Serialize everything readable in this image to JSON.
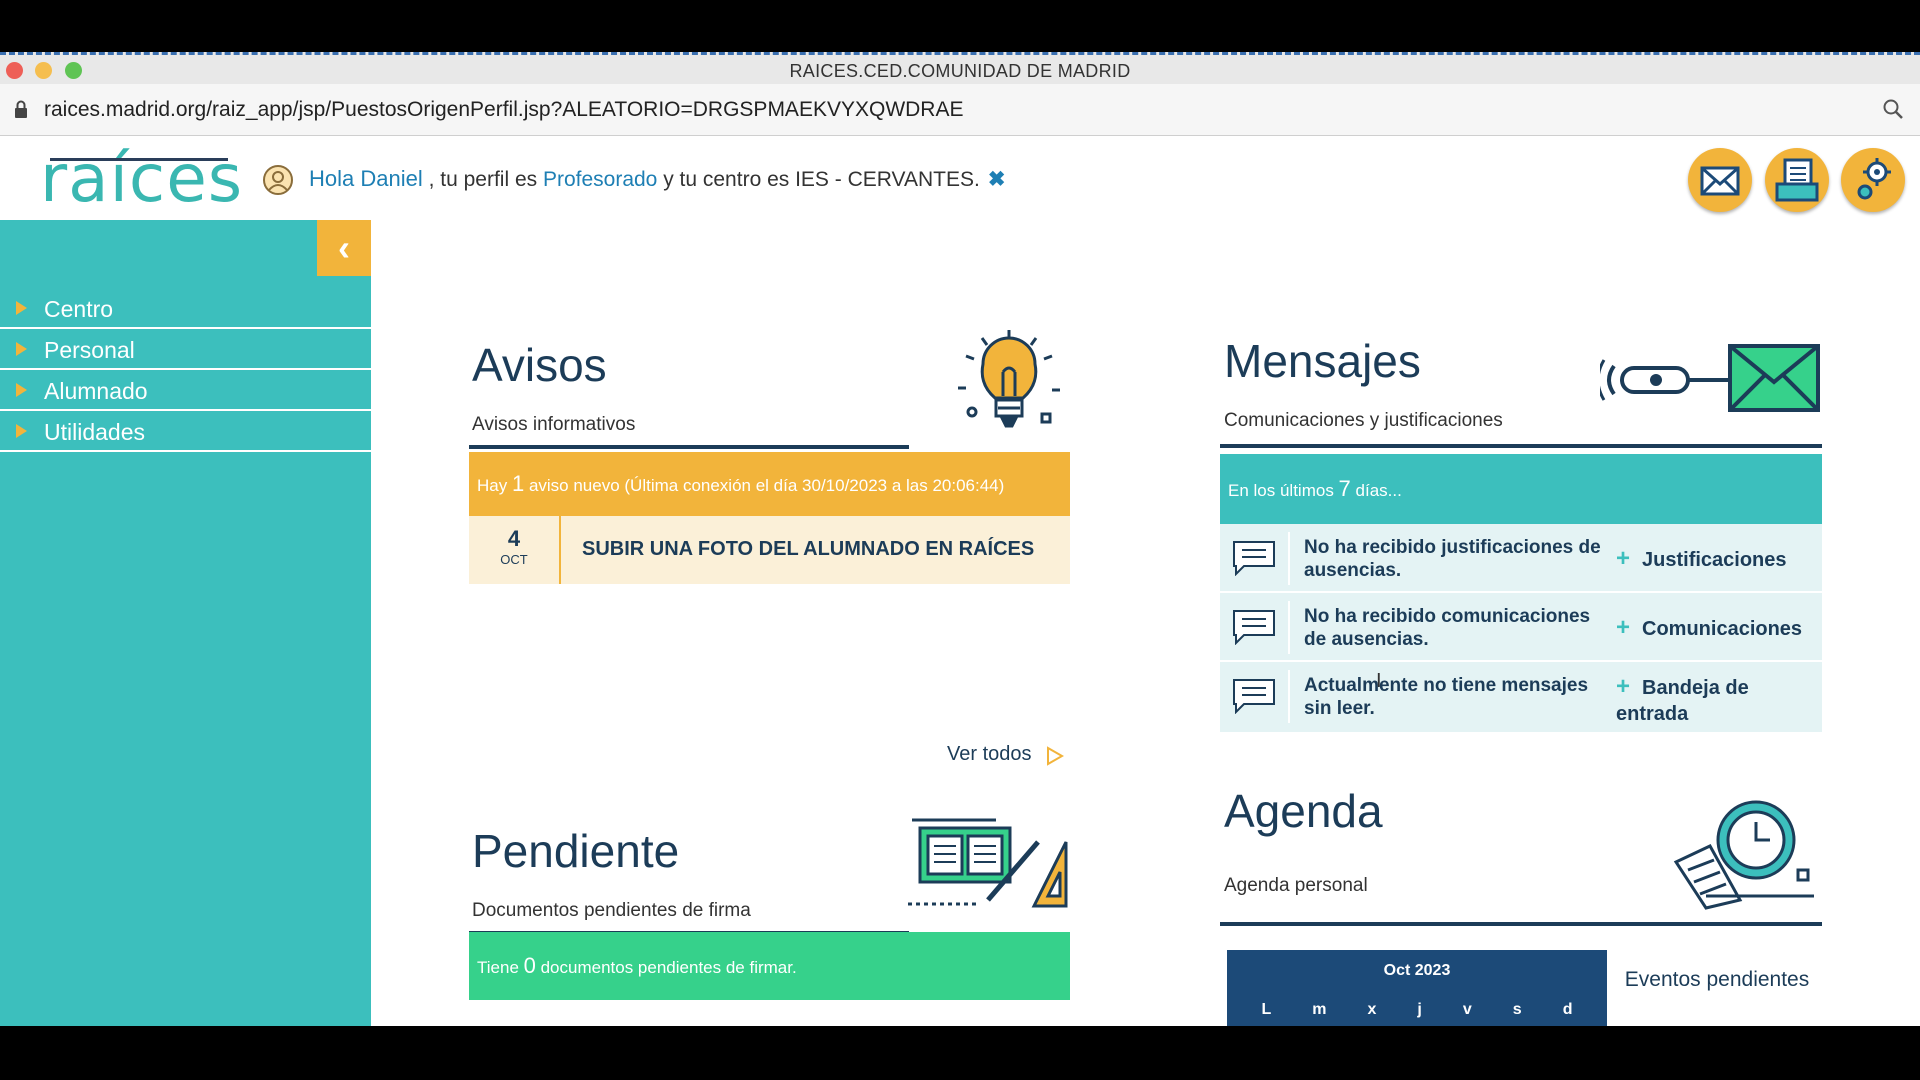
{
  "window": {
    "title": "RAICES.CED.COMUNIDAD DE MADRID",
    "url": "raices.madrid.org/raiz_app/jsp/PuestosOrigenPerfil.jsp?ALEATORIO=DRGSPMAEKVYXQWDRAE"
  },
  "header": {
    "logo": "raíces",
    "greeting_hello": "Hola Daniel",
    "greeting_profile_pre": " , tu perfil es ",
    "greeting_profile": "Profesorado",
    "greeting_center": " y tu centro es IES - CERVANTES.",
    "icons": [
      "mail-icon",
      "documents-icon",
      "settings-icon"
    ]
  },
  "sidebar": {
    "collapse_glyph": "‹",
    "items": [
      {
        "label": "Centro"
      },
      {
        "label": "Personal"
      },
      {
        "label": "Alumnado"
      },
      {
        "label": "Utilidades"
      }
    ]
  },
  "avisos": {
    "title": "Avisos",
    "subtitle": "Avisos informativos",
    "banner_pre": "Hay ",
    "banner_count": "1",
    "banner_post": " aviso nuevo (Última conexión el día 30/10/2023 a las 20:06:44)",
    "items": [
      {
        "day": "4",
        "month": "OCT",
        "title": "SUBIR UNA FOTO DEL ALUMNADO EN RAÍCES"
      }
    ],
    "ver_todos": "Ver todos"
  },
  "pendiente": {
    "title": "Pendiente",
    "subtitle": "Documentos pendientes de firma",
    "banner_pre": "Tiene ",
    "banner_count": "0",
    "banner_post": " documentos pendientes de firmar."
  },
  "mensajes": {
    "title": "Mensajes",
    "subtitle": "Comunicaciones y justificaciones",
    "banner_pre": "En los últimos ",
    "banner_count": "7",
    "banner_post": " días...",
    "rows": [
      {
        "text": "No ha recibido justificaciones de ausencias.",
        "link": "Justificaciones"
      },
      {
        "text": "No ha recibido comunicaciones de ausencias.",
        "link": "Comunicaciones"
      },
      {
        "text": "Actualmente no tiene mensajes sin leer.",
        "link": "Bandeja de entrada"
      }
    ]
  },
  "agenda": {
    "title": "Agenda",
    "subtitle": "Agenda personal",
    "calendar_month": "Oct 2023",
    "weekdays": [
      "L",
      "m",
      "x",
      "j",
      "v",
      "s",
      "d"
    ],
    "eventos": "Eventos pendientes"
  },
  "colors": {
    "teal": "#3cbfbd",
    "orange": "#f2b43b",
    "navy": "#1c3c58",
    "green": "#36d18b"
  }
}
